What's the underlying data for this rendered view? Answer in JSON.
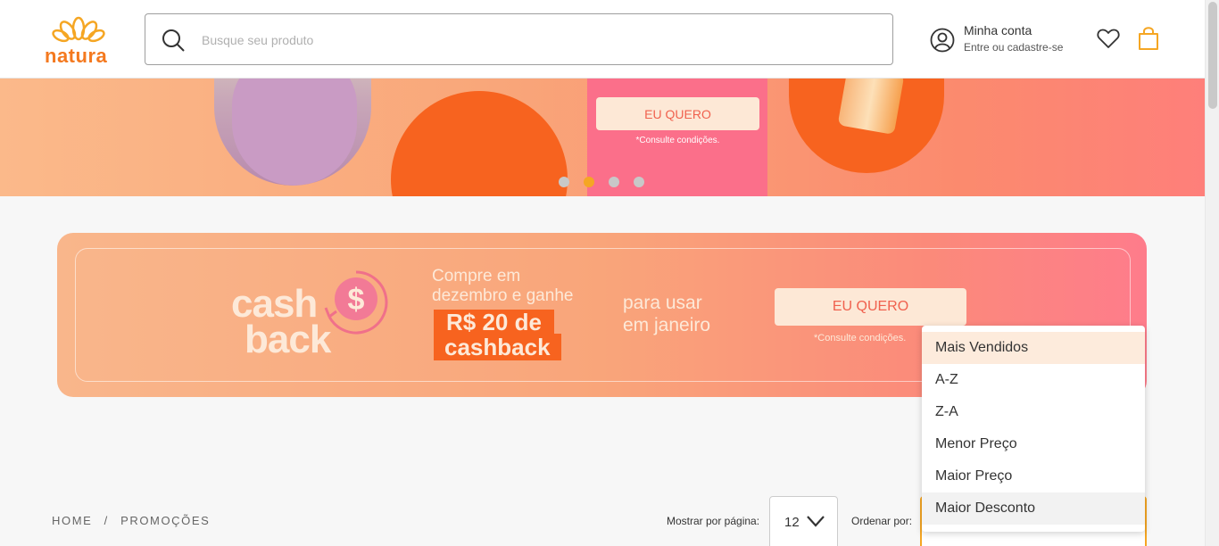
{
  "header": {
    "logo_text": "natura",
    "search": {
      "placeholder": "Busque seu produto"
    },
    "account": {
      "title": "Minha conta",
      "subtitle": "Entre ou cadastre-se"
    }
  },
  "hero": {
    "cta_label": "EU QUERO",
    "note": "*Consulte condições.",
    "carousel": {
      "count": 4,
      "active_index": 1
    }
  },
  "cashback_banner": {
    "word_cash": "cash",
    "word_back": "back",
    "line1": "Compre em",
    "line2": "dezembro e ganhe",
    "highlight1": "R$ 20 de",
    "highlight2": "cashback",
    "use1": "para usar",
    "use2": "em janeiro",
    "cta_label": "EU QUERO",
    "note": "*Consulte condições."
  },
  "breadcrumb": {
    "items": [
      "HOME",
      "/",
      "PROMOÇÕES"
    ]
  },
  "controls": {
    "per_page_label": "Mostrar por página:",
    "per_page_value": "12",
    "order_label": "Ordenar por:"
  },
  "dropdown": {
    "options": [
      "Mais Vendidos",
      "A-Z",
      "Z-A",
      "Menor Preço",
      "Maior Preço",
      "Maior Desconto"
    ],
    "selected_index": 0,
    "hover_index": 5
  },
  "colors": {
    "brand_orange": "#f4791f",
    "accent_yellow": "#f5a623",
    "banner_orange": "#f7631f",
    "banner_pink": "#fb6f8a"
  }
}
